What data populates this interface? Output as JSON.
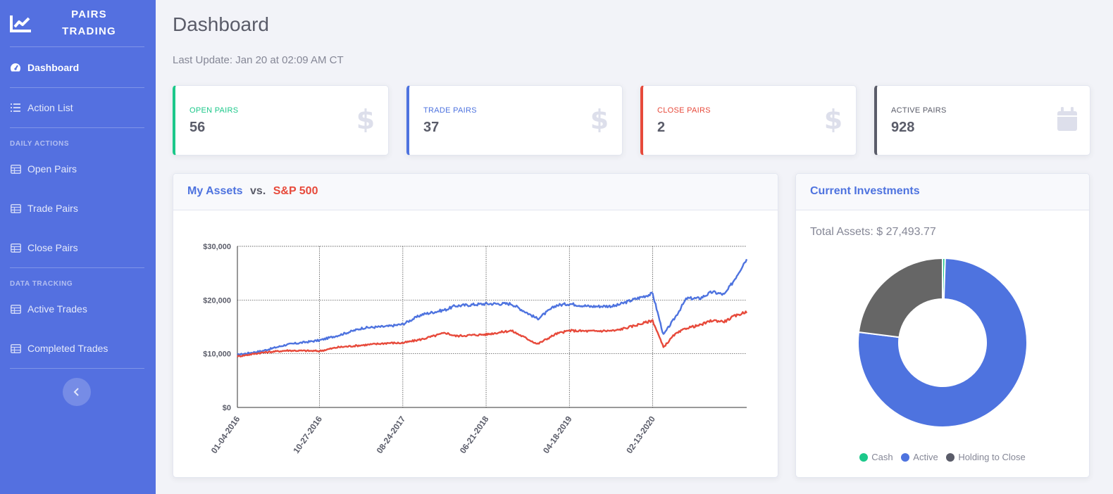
{
  "brand": {
    "line1": "PAIRS",
    "line2": "TRADING"
  },
  "sidebar": {
    "dashboard": "Dashboard",
    "action_list": "Action List",
    "daily_actions": "DAILY ACTIONS",
    "open_pairs": "Open Pairs",
    "trade_pairs": "Trade Pairs",
    "close_pairs": "Close Pairs",
    "data_tracking": "DATA TRACKING",
    "active_trades": "Active Trades",
    "completed_trades": "Completed Trades"
  },
  "page": {
    "title": "Dashboard",
    "last_update": "Last Update: Jan 20 at 02:09 AM CT"
  },
  "stats": [
    {
      "label": "OPEN PAIRS",
      "value": "56",
      "color": "#1cc88a",
      "icon": "dollar-icon"
    },
    {
      "label": "TRADE PAIRS",
      "value": "37",
      "color": "#4e73df",
      "icon": "dollar-icon"
    },
    {
      "label": "CLOSE PAIRS",
      "value": "2",
      "color": "#e74a3b",
      "icon": "dollar-icon"
    },
    {
      "label": "ACTIVE PAIRS",
      "value": "928",
      "color": "#5a5c69",
      "icon": "calendar-icon"
    }
  ],
  "assets_card": {
    "title_a": "My Assets",
    "vs": "vs.",
    "title_b": "S&P 500"
  },
  "investments_card": {
    "title": "Current Investments",
    "total": "Total Assets: $ 27,493.77",
    "legend": [
      "Cash",
      "Active",
      "Holding to Close"
    ]
  },
  "chart_data": [
    {
      "type": "line",
      "x_tick_labels": [
        "01-04-2016",
        "10-27-2016",
        "08-24-2017",
        "06-21-2018",
        "04-18-2019",
        "02-13-2020"
      ],
      "y_tick_labels": [
        "$0",
        "$10,000",
        "$20,000",
        "$30,000"
      ],
      "ylim": [
        0,
        30000
      ],
      "grid": true,
      "series": [
        {
          "name": "My Assets",
          "color": "#4e73df",
          "x": [
            "2016-01-04",
            "2016-04-01",
            "2016-07-01",
            "2016-10-27",
            "2017-01-01",
            "2017-04-01",
            "2017-07-01",
            "2017-08-24",
            "2017-11-01",
            "2018-01-26",
            "2018-03-01",
            "2018-06-21",
            "2018-09-20",
            "2018-12-24",
            "2019-03-01",
            "2019-04-18",
            "2019-07-01",
            "2019-10-01",
            "2019-12-01",
            "2020-02-13",
            "2020-03-23",
            "2020-05-01",
            "2020-06-15",
            "2020-08-01",
            "2020-09-15",
            "2020-10-30",
            "2020-12-01",
            "2021-01-15"
          ],
          "values": [
            9800,
            10500,
            11700,
            12500,
            13400,
            14800,
            15100,
            15500,
            17300,
            18200,
            18900,
            19300,
            19300,
            16500,
            19000,
            19300,
            18800,
            18900,
            20000,
            21200,
            13500,
            16500,
            20300,
            20300,
            21500,
            21000,
            23500,
            27500
          ]
        },
        {
          "name": "S&P 500",
          "color": "#e74a3b",
          "x": [
            "2016-01-04",
            "2016-04-01",
            "2016-07-01",
            "2016-10-27",
            "2017-01-01",
            "2017-04-01",
            "2017-07-01",
            "2017-08-24",
            "2017-11-01",
            "2018-01-26",
            "2018-03-01",
            "2018-06-21",
            "2018-09-20",
            "2018-12-24",
            "2019-03-01",
            "2019-04-18",
            "2019-07-01",
            "2019-10-01",
            "2019-12-01",
            "2020-02-13",
            "2020-03-23",
            "2020-05-01",
            "2020-06-15",
            "2020-08-01",
            "2020-09-15",
            "2020-10-30",
            "2020-12-01",
            "2021-01-15"
          ],
          "values": [
            9500,
            10200,
            10600,
            10500,
            11200,
            11600,
            12000,
            12000,
            12700,
            13900,
            13300,
            13600,
            14300,
            11800,
            13700,
            14300,
            14200,
            14300,
            15100,
            16200,
            11200,
            13500,
            14800,
            15300,
            16200,
            16000,
            16900,
            17800
          ]
        }
      ]
    },
    {
      "type": "pie",
      "categories": [
        "Cash",
        "Active",
        "Holding to Close"
      ],
      "values": [
        0.5,
        76.5,
        23
      ],
      "colors": [
        "#1cc88a",
        "#4e73df",
        "#666666"
      ]
    }
  ]
}
